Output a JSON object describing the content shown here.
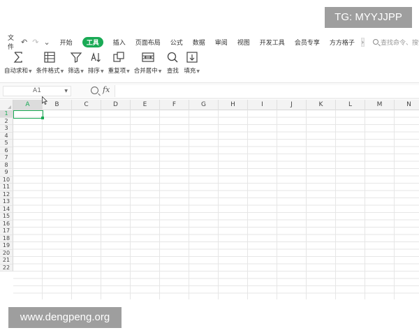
{
  "watermarks": {
    "top": "TG: MYYJJPP",
    "bottom": "www.dengpeng.org"
  },
  "menubar": {
    "file_label": "文件",
    "tabs": [
      {
        "label": "开始",
        "active": false
      },
      {
        "label": "工具",
        "active": true
      },
      {
        "label": "插入",
        "active": false
      },
      {
        "label": "页面布局",
        "active": false
      },
      {
        "label": "公式",
        "active": false
      },
      {
        "label": "数据",
        "active": false
      },
      {
        "label": "审阅",
        "active": false
      },
      {
        "label": "视图",
        "active": false
      },
      {
        "label": "开发工具",
        "active": false
      },
      {
        "label": "会员专享",
        "active": false
      },
      {
        "label": "方方格子",
        "active": false
      }
    ],
    "search_placeholder": "查找命令、搜索模板"
  },
  "toolbar": [
    {
      "label": "自动求和",
      "icon": "sum-icon",
      "caret": true
    },
    {
      "label": "条件格式",
      "icon": "conditional-format-icon",
      "caret": true
    },
    {
      "label": "筛选",
      "icon": "filter-icon",
      "caret": true
    },
    {
      "label": "排序",
      "icon": "sort-icon",
      "caret": true
    },
    {
      "label": "重复项",
      "icon": "duplicates-icon",
      "caret": true
    },
    {
      "label": "合并居中",
      "icon": "merge-center-icon",
      "caret": true
    },
    {
      "label": "查找",
      "icon": "find-icon",
      "caret": false
    },
    {
      "label": "填充",
      "icon": "fill-icon",
      "caret": true
    }
  ],
  "formula_bar": {
    "cell_ref": "A1",
    "fx_label": "fx",
    "value": ""
  },
  "sheet": {
    "columns": [
      "A",
      "B",
      "C",
      "D",
      "E",
      "F",
      "G",
      "H",
      "I",
      "J",
      "K",
      "L",
      "M",
      "N"
    ],
    "rows": [
      "1",
      "2",
      "3",
      "4",
      "5",
      "6",
      "7",
      "8",
      "9",
      "10",
      "11",
      "12",
      "13",
      "14",
      "15",
      "16",
      "17",
      "18",
      "19",
      "20",
      "21",
      "22"
    ],
    "active_column": "A",
    "active_row": "1"
  },
  "colors": {
    "accent": "#1aaa55",
    "watermark_bg": "#9e9e9e"
  }
}
